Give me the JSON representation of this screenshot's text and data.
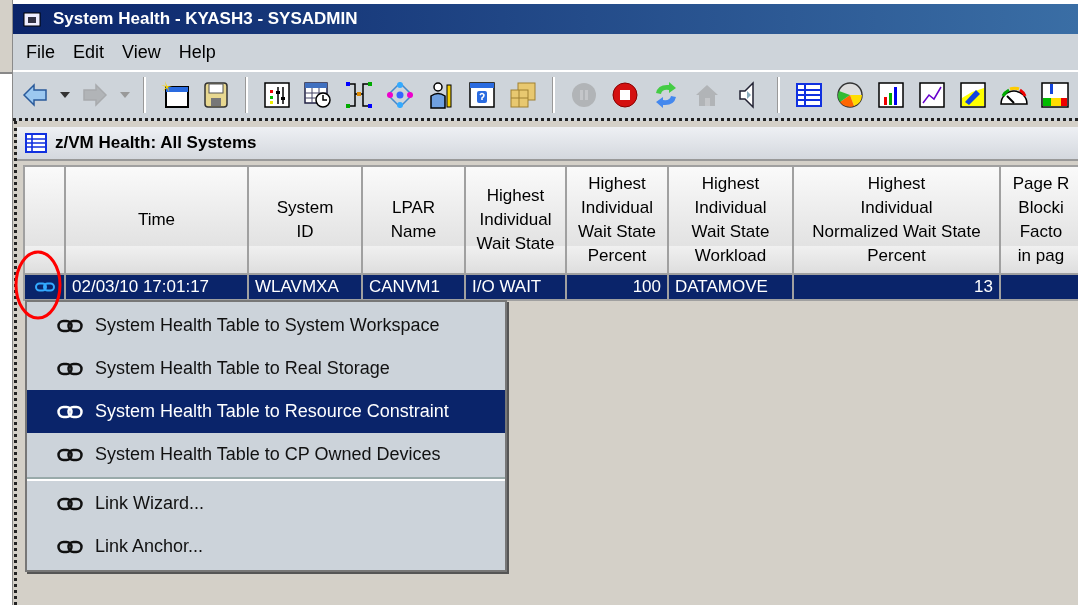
{
  "window": {
    "title": "System Health - KYASH3 - SYSADMIN"
  },
  "menu_bar": [
    "File",
    "Edit",
    "View",
    "Help"
  ],
  "toolbar": [
    {
      "kind": "back",
      "disabled": false
    },
    {
      "kind": "dropdown",
      "disabled": false
    },
    {
      "kind": "forward",
      "disabled": true
    },
    {
      "kind": "dropdown",
      "disabled": true
    },
    {
      "kind": "separator"
    },
    {
      "kind": "new-window",
      "disabled": false
    },
    {
      "kind": "save",
      "disabled": false
    },
    {
      "kind": "separator"
    },
    {
      "kind": "properties",
      "disabled": false
    },
    {
      "kind": "schedule",
      "disabled": false
    },
    {
      "kind": "topology",
      "disabled": false
    },
    {
      "kind": "network",
      "disabled": false
    },
    {
      "kind": "user",
      "disabled": false
    },
    {
      "kind": "help",
      "disabled": false
    },
    {
      "kind": "stack",
      "disabled": false
    },
    {
      "kind": "separator"
    },
    {
      "kind": "pause",
      "disabled": true
    },
    {
      "kind": "stop",
      "disabled": false
    },
    {
      "kind": "refresh",
      "disabled": false
    },
    {
      "kind": "home",
      "disabled": true
    },
    {
      "kind": "speaker",
      "disabled": false
    },
    {
      "kind": "separator"
    },
    {
      "kind": "table",
      "disabled": false
    },
    {
      "kind": "pie",
      "disabled": false
    },
    {
      "kind": "bar",
      "disabled": false
    },
    {
      "kind": "line",
      "disabled": false
    },
    {
      "kind": "area",
      "disabled": false
    },
    {
      "kind": "gauge",
      "disabled": false
    },
    {
      "kind": "ruler",
      "disabled": false
    }
  ],
  "workspace": {
    "title": "z/VM Health: All Systems"
  },
  "table": {
    "columns": [
      "Time",
      "System\nID",
      "LPAR\nName",
      "Highest\nIndividual\nWait State",
      "Highest\nIndividual\nWait State\nPercent",
      "Highest\nIndividual\nWait State\nWorkload",
      "Highest\nIndividual\nNormalized Wait State\nPercent",
      "Page R\nBlocki\nFacto\nin pag"
    ],
    "rows": [
      {
        "selected": true,
        "cells": [
          "02/03/10 17:01:17",
          "WLAVMXA",
          "CANVM1",
          "I/O WAIT",
          "100",
          "DATAMOVE",
          "13",
          ""
        ]
      }
    ]
  },
  "context_menu": [
    {
      "kind": "item",
      "label": "System Health Table to System Workspace",
      "selected": false
    },
    {
      "kind": "item",
      "label": "System Health Table to Real Storage",
      "selected": false
    },
    {
      "kind": "item",
      "label": "System Health Table to Resource Constraint",
      "selected": true
    },
    {
      "kind": "item",
      "label": "System Health Table to CP Owned Devices",
      "selected": false
    },
    {
      "kind": "separator"
    },
    {
      "kind": "item",
      "label": "Link Wizard...",
      "selected": false
    },
    {
      "kind": "item",
      "label": "Link Anchor...",
      "selected": false
    }
  ]
}
